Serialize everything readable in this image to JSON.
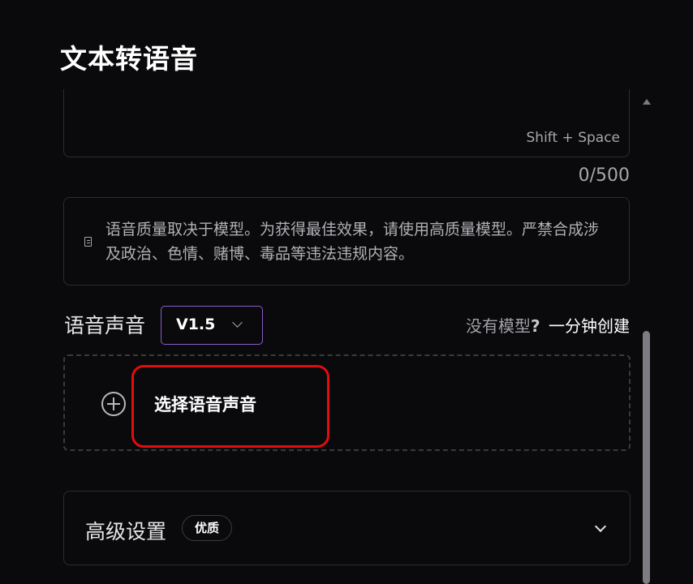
{
  "page": {
    "title": "文本转语音"
  },
  "text_input": {
    "shortcut_hint": "Shift + Space",
    "counter": "0/500"
  },
  "notice": {
    "icon": "document-icon",
    "text": "语音质量取决于模型。为获得最佳效果，请使用高质量模型。严禁合成涉及政治、色情、赌博、毒品等违法违规内容。"
  },
  "voice": {
    "label": "语音声音",
    "version": "V1.5",
    "no_model_text": "没有模型",
    "question_mark": "?",
    "create_link": "一分钟创建",
    "select_button": "选择语音声音",
    "select_icon": "plus-circle-icon"
  },
  "advanced": {
    "label": "高级设置",
    "badge": "优质",
    "expand_icon": "chevron-down-icon"
  },
  "colors": {
    "background": "#0a0a0c",
    "accent_border": "#8a5cc8",
    "highlight": "#e10d0d"
  }
}
